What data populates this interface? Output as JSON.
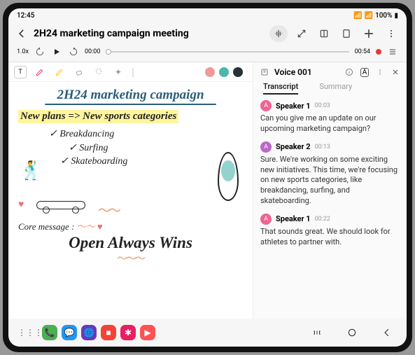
{
  "status": {
    "time": "12:45",
    "battery": "100%"
  },
  "header": {
    "title": "2H24 marketing campaign meeting"
  },
  "playback": {
    "speed": "1.0x",
    "current": "00:00",
    "total": "00:54"
  },
  "colors": {
    "c1": "#ef9a9a",
    "c2": "#4db6ac",
    "c3": "#263238"
  },
  "note": {
    "title": "2H24 marketing campaign",
    "highlight": "New plans => New sports categories",
    "items": [
      "Breakdancing",
      "Surfing",
      "Skateboarding"
    ],
    "core_label": "Core message :",
    "slogan": "Open Always Wins"
  },
  "panel": {
    "title": "Voice 001",
    "tabs": {
      "transcript": "Transcript",
      "summary": "Summary"
    },
    "entries": [
      {
        "speaker": "Speaker 1",
        "time": "00:03",
        "color": "#f06292",
        "initial": "A",
        "text": "Can you give me an update on our upcoming marketing campaign?"
      },
      {
        "speaker": "Speaker 2",
        "time": "00:13",
        "color": "#ba68c8",
        "initial": "A",
        "text": "Sure. We're working on some exciting new initiatives. This time, we're focusing on new sports categories, like breakdancing, surfing, and skateboarding."
      },
      {
        "speaker": "Speaker 1",
        "time": "00:22",
        "color": "#f06292",
        "initial": "A",
        "text": "That sounds great. We should look for athletes to partner with."
      }
    ]
  },
  "dock": [
    {
      "color": "#4caf50",
      "glyph": "📞"
    },
    {
      "color": "#2196f3",
      "glyph": "💬"
    },
    {
      "color": "#673ab7",
      "glyph": "🌐"
    },
    {
      "color": "#f44336",
      "glyph": "■"
    },
    {
      "color": "#e91e63",
      "glyph": "✱"
    },
    {
      "color": "#ff5252",
      "glyph": "▶"
    }
  ]
}
